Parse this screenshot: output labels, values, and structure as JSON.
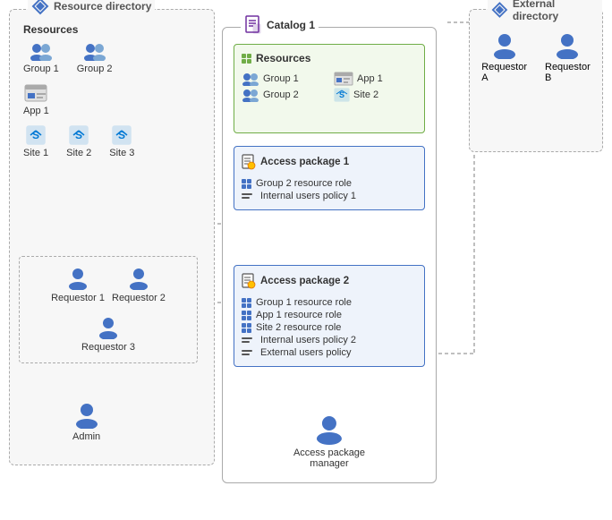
{
  "resourceDirectory": {
    "label": "Resource directory",
    "sections": {
      "resources": "Resources",
      "items": [
        {
          "name": "Group 1",
          "type": "group"
        },
        {
          "name": "Group 2",
          "type": "group"
        },
        {
          "name": "App 1",
          "type": "app"
        },
        {
          "name": "Site 1",
          "type": "site"
        },
        {
          "name": "Site 2",
          "type": "site"
        },
        {
          "name": "Site 3",
          "type": "site"
        }
      ],
      "requestors": [
        {
          "name": "Requestor 1",
          "type": "user"
        },
        {
          "name": "Requestor 2",
          "type": "user"
        },
        {
          "name": "Requestor 3",
          "type": "user"
        }
      ],
      "admin": {
        "name": "Admin",
        "type": "admin"
      }
    }
  },
  "externalDirectory": {
    "label": "External directory",
    "users": [
      {
        "name": "Requestor A"
      },
      {
        "name": "Requestor B"
      }
    ]
  },
  "catalog": {
    "label": "Catalog 1",
    "resources": {
      "label": "Resources",
      "items": [
        {
          "name": "Group 1",
          "col": 1
        },
        {
          "name": "App 1",
          "col": 2
        },
        {
          "name": "Group 2",
          "col": 1
        },
        {
          "name": "Site 2",
          "col": 2
        }
      ]
    },
    "accessPackage1": {
      "label": "Access package 1",
      "items": [
        {
          "type": "resource",
          "text": "Group 2 resource role"
        },
        {
          "type": "policy",
          "text": "Internal users policy 1"
        }
      ]
    },
    "accessPackage2": {
      "label": "Access package 2",
      "items": [
        {
          "type": "resource",
          "text": "Group 1 resource role"
        },
        {
          "type": "resource",
          "text": "App 1 resource role"
        },
        {
          "type": "resource",
          "text": "Site 2 resource role"
        },
        {
          "type": "policy",
          "text": "Internal users policy 2"
        },
        {
          "type": "policy",
          "text": "External users policy"
        }
      ]
    },
    "manager": {
      "name": "Access package\nmanager"
    }
  }
}
